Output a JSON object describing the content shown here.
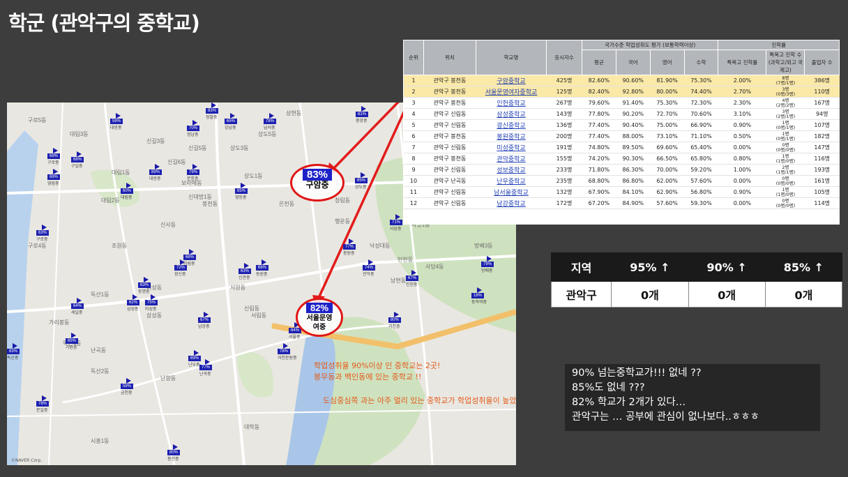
{
  "title": "학군 (관악구의 중학교)",
  "table": {
    "headers": {
      "rank": "순위",
      "location": "위치",
      "school": "학교명",
      "examinees": "응시자수",
      "eval_group": "국가수준 학업성취도 평가 (보통학력이상)",
      "avg": "평균",
      "korean": "국어",
      "english": "영어",
      "math": "수학",
      "advance_group": "진학률",
      "special": "특목고 진학률",
      "special_detail": "특목고 진학 수 (과학고/외고 국제고)",
      "grads": "졸업자 수"
    },
    "rows": [
      {
        "rank": "1",
        "loc": "관악구 봉천동",
        "name": "구암중학교",
        "n": "425명",
        "avg": "82.60%",
        "kor": "90.60%",
        "eng": "81.90%",
        "math": "75.30%",
        "sp": "2.00%",
        "spd": "8명",
        "spd2": "(7명/1명)",
        "grad": "386명",
        "hl": true
      },
      {
        "rank": "2",
        "loc": "관악구 봉천동",
        "name": "서울문영여자중학교",
        "n": "125명",
        "avg": "82.40%",
        "kor": "92.80%",
        "eng": "80.00%",
        "math": "74.40%",
        "sp": "2.70%",
        "spd": "3명",
        "spd2": "(0명/3명)",
        "grad": "110명",
        "hl": true
      },
      {
        "rank": "3",
        "loc": "관악구 봉천동",
        "name": "인헌중학교",
        "n": "267명",
        "avg": "79.60%",
        "kor": "91.40%",
        "eng": "75.30%",
        "math": "72.30%",
        "sp": "2.30%",
        "spd": "4명",
        "spd2": "(2명/2명)",
        "grad": "167명",
        "hl": false
      },
      {
        "rank": "4",
        "loc": "관악구 신림동",
        "name": "삼성중학교",
        "n": "143명",
        "avg": "77.80%",
        "kor": "90.20%",
        "eng": "72.70%",
        "math": "70.60%",
        "sp": "3.10%",
        "spd": "3명",
        "spd2": "(2명/1명)",
        "grad": "94명",
        "hl": false
      },
      {
        "rank": "5",
        "loc": "관악구 신림동",
        "name": "광신중학교",
        "n": "136명",
        "avg": "77.40%",
        "kor": "90.40%",
        "eng": "75.00%",
        "math": "66.90%",
        "sp": "0.90%",
        "spd": "1명",
        "spd2": "(0명/1명)",
        "grad": "107명",
        "hl": false
      },
      {
        "rank": "6",
        "loc": "관악구 봉천동",
        "name": "봉원중학교",
        "n": "200명",
        "avg": "77.40%",
        "kor": "88.00%",
        "eng": "73.10%",
        "math": "71.10%",
        "sp": "0.50%",
        "spd": "1명",
        "spd2": "(0명/1명)",
        "grad": "182명",
        "hl": false
      },
      {
        "rank": "7",
        "loc": "관악구 신림동",
        "name": "미성중학교",
        "n": "191명",
        "avg": "74.80%",
        "kor": "89.50%",
        "eng": "69.60%",
        "math": "65.40%",
        "sp": "0.00%",
        "spd": "0명",
        "spd2": "(0명/0명)",
        "grad": "147명",
        "hl": false
      },
      {
        "rank": "8",
        "loc": "관악구 봉천동",
        "name": "관악중학교",
        "n": "155명",
        "avg": "74.20%",
        "kor": "90.30%",
        "eng": "66.50%",
        "math": "65.80%",
        "sp": "0.80%",
        "spd": "1명",
        "spd2": "(1명/0명)",
        "grad": "116명",
        "hl": false
      },
      {
        "rank": "9",
        "loc": "관악구 신림동",
        "name": "성보중학교",
        "n": "233명",
        "avg": "71.80%",
        "kor": "86.30%",
        "eng": "70.00%",
        "math": "59.20%",
        "sp": "1.00%",
        "spd": "2명",
        "spd2": "(1명/1명)",
        "grad": "193명",
        "hl": false
      },
      {
        "rank": "10",
        "loc": "관악구 난곡동",
        "name": "난우중학교",
        "n": "235명",
        "avg": "68.80%",
        "kor": "86.80%",
        "eng": "62.00%",
        "math": "57.60%",
        "sp": "0.00%",
        "spd": "0명",
        "spd2": "(0명/0명)",
        "grad": "161명",
        "hl": false
      },
      {
        "rank": "11",
        "loc": "관악구 신림동",
        "name": "남서울중학교",
        "n": "132명",
        "avg": "67.90%",
        "kor": "84.10%",
        "eng": "62.90%",
        "math": "56.80%",
        "sp": "0.90%",
        "spd": "1명",
        "spd2": "(1명/0명)",
        "grad": "105명",
        "hl": false
      },
      {
        "rank": "12",
        "loc": "관악구 신림동",
        "name": "남강중학교",
        "n": "172명",
        "avg": "67.20%",
        "kor": "84.90%",
        "eng": "57.60%",
        "math": "59.30%",
        "sp": "0.00%",
        "spd": "0명",
        "spd2": "(0명/0명)",
        "grad": "114명",
        "hl": false
      }
    ]
  },
  "summary": {
    "headers": [
      "지역",
      "95% ↑",
      "90% ↑",
      "85% ↑"
    ],
    "row": [
      "관악구",
      "0개",
      "0개",
      "0개"
    ]
  },
  "comment": {
    "lines": [
      "90% 넘는중학교가!!! 없네 ??",
      "85%도 없네 ???",
      "82% 학교가 2개가 있다…",
      "관악구는 … 공부에 관심이 없나보다..ㅎㅎㅎ"
    ]
  },
  "map": {
    "callouts": [
      {
        "pct": "83%",
        "school": "구암중"
      },
      {
        "pct": "82%",
        "school": "서울문영여중"
      }
    ],
    "notes": [
      "학업성취율 90%이상 인 중학교는 2곳!",
      "봉무동과 백인동에 있는 중학교 !!",
      "도심중심쪽 과는 아주 멀리 있는 중학교가 학업성취율이 높았다."
    ],
    "pins": [
      {
        "pct": "83%",
        "nm": "정발중"
      },
      {
        "pct": "70%",
        "nm": "정남중"
      },
      {
        "pct": "59%",
        "nm": "대방중"
      },
      {
        "pct": "65%",
        "nm": "강남중"
      },
      {
        "pct": "78%",
        "nm": "남서중"
      },
      {
        "pct": "81%",
        "nm": "중앙중"
      },
      {
        "pct": "69%",
        "nm": "구로중"
      },
      {
        "pct": "68%",
        "nm": "구일중"
      },
      {
        "pct": "69%",
        "nm": "영림중"
      },
      {
        "pct": "89%",
        "nm": "대방중"
      },
      {
        "pct": "79%",
        "nm": "문창중"
      },
      {
        "pct": "60%",
        "nm": "대림중"
      },
      {
        "pct": "65%",
        "nm": "영등중"
      },
      {
        "pct": "85%",
        "nm": "상도중"
      },
      {
        "pct": "63%",
        "nm": "구로중"
      },
      {
        "pct": "71%",
        "nm": "사당중"
      },
      {
        "pct": "77%",
        "nm": "봉원중"
      },
      {
        "pct": "68%",
        "nm": "미림중"
      },
      {
        "pct": "63%",
        "nm": "신관중"
      },
      {
        "pct": "66%",
        "nm": "동원중"
      },
      {
        "pct": "74%",
        "nm": "관악중"
      },
      {
        "pct": "67%",
        "nm": "인헌중"
      },
      {
        "pct": "79%",
        "nm": "방배중"
      },
      {
        "pct": "72%",
        "nm": "광신중"
      },
      {
        "pct": "63%",
        "nm": "동명중"
      },
      {
        "pct": "62%",
        "nm": "삼성중"
      },
      {
        "pct": "75%",
        "nm": "미성중"
      },
      {
        "pct": "64%",
        "nm": "세일중"
      },
      {
        "pct": "18%",
        "nm": "동작여중"
      },
      {
        "pct": "67%",
        "nm": "남강중"
      },
      {
        "pct": "80%",
        "nm": "과천중"
      },
      {
        "pct": "64%",
        "nm": "서울중"
      },
      {
        "pct": "65%",
        "nm": "가원중"
      },
      {
        "pct": "78%",
        "nm": "과천문원중"
      },
      {
        "pct": "69%",
        "nm": "난우중"
      },
      {
        "pct": "77%",
        "nm": "난곡중"
      },
      {
        "pct": "59%",
        "nm": "금천중"
      },
      {
        "pct": "78%",
        "nm": "문일중"
      },
      {
        "pct": "80%",
        "nm": "봉천중"
      },
      {
        "pct": "83%",
        "nm": "독산중"
      }
    ],
    "labels": [
      "구로5동",
      "대림3동",
      "신길3동",
      "신길6동",
      "대림1동",
      "대림2동",
      "신길5동",
      "상도1동",
      "상도3동",
      "상도5동",
      "신대방1동",
      "보라매동",
      "은천동",
      "청림동",
      "행운동",
      "낙성대동",
      "인헌동",
      "서원동",
      "신림동",
      "신사동",
      "조원동",
      "미성동",
      "난곡동",
      "난향동",
      "서림동",
      "삼성동",
      "대학동",
      "독산1동",
      "독산2동",
      "독산4동",
      "시흥1동",
      "구로4동",
      "가리봉동",
      "남현동",
      "사당1동",
      "사당4동",
      "방배3동",
      "봉천동",
      "중앙동",
      "성현동"
    ],
    "credit": "©NAVER Corp."
  }
}
